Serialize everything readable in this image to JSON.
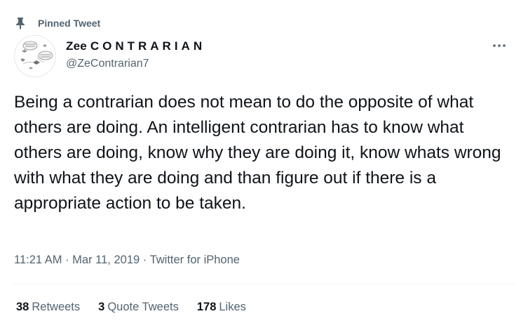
{
  "pinned": {
    "label": "Pinned Tweet"
  },
  "author": {
    "display_name": "Zee",
    "display_name_spaced": "CONTRARIAN",
    "handle": "@ZeContrarian7"
  },
  "tweet": {
    "text": "Being a contrarian does not mean to do the opposite of what others are doing. An intelligent contrarian has to know what others are doing, know why they are doing it, know whats wrong with what they are doing and than figure out if there is a appropriate action to be taken."
  },
  "meta": {
    "time": "11:21 AM",
    "sep1": " · ",
    "date": "Mar 11, 2019",
    "sep2": " · ",
    "source": "Twitter for iPhone"
  },
  "stats": {
    "retweets_count": "38",
    "retweets_label": "Retweets",
    "quotes_count": "3",
    "quotes_label": "Quote Tweets",
    "likes_count": "178",
    "likes_label": "Likes"
  },
  "icons": {
    "pin": "pin-icon",
    "more": "more-icon",
    "avatar": "avatar"
  },
  "colors": {
    "text_primary": "#0f1419",
    "text_secondary": "#536471",
    "divider": "#eff3f4"
  }
}
